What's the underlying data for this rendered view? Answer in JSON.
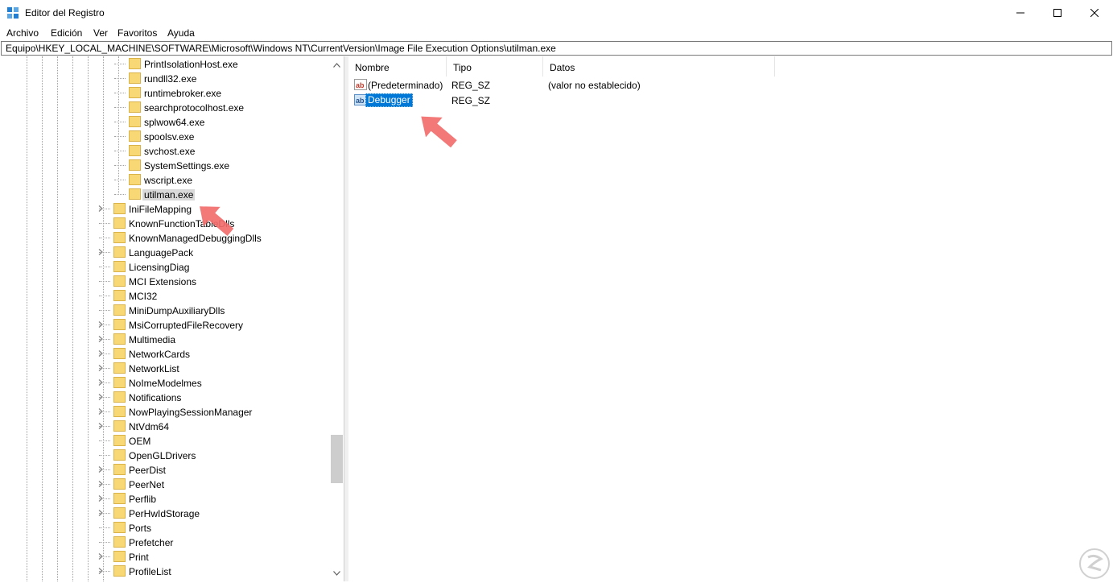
{
  "window": {
    "title": "Editor del Registro",
    "icon": "registry-editor-icon",
    "controls": [
      "minimize-icon",
      "maximize-icon",
      "close-icon"
    ]
  },
  "menu": [
    "Archivo",
    "Edición",
    "Ver",
    "Favoritos",
    "Ayuda"
  ],
  "address": "Equipo\\HKEY_LOCAL_MACHINE\\SOFTWARE\\Microsoft\\Windows NT\\CurrentVersion\\Image File Execution Options\\utilman.exe",
  "tree": {
    "children": [
      {
        "label": "PrintIsolationHost.exe"
      },
      {
        "label": "rundll32.exe"
      },
      {
        "label": "runtimebroker.exe"
      },
      {
        "label": "searchprotocolhost.exe"
      },
      {
        "label": "splwow64.exe"
      },
      {
        "label": "spoolsv.exe"
      },
      {
        "label": "svchost.exe"
      },
      {
        "label": "SystemSettings.exe"
      },
      {
        "label": "wscript.exe"
      },
      {
        "label": "utilman.exe",
        "selected": true
      }
    ],
    "siblings": [
      {
        "label": "IniFileMapping",
        "expandable": true
      },
      {
        "label": "KnownFunctionTableDlls",
        "expandable": false
      },
      {
        "label": "KnownManagedDebuggingDlls",
        "expandable": false
      },
      {
        "label": "LanguagePack",
        "expandable": true
      },
      {
        "label": "LicensingDiag",
        "expandable": false
      },
      {
        "label": "MCI Extensions",
        "expandable": false
      },
      {
        "label": "MCI32",
        "expandable": false
      },
      {
        "label": "MiniDumpAuxiliaryDlls",
        "expandable": false
      },
      {
        "label": "MsiCorruptedFileRecovery",
        "expandable": true
      },
      {
        "label": "Multimedia",
        "expandable": true
      },
      {
        "label": "NetworkCards",
        "expandable": true
      },
      {
        "label": "NetworkList",
        "expandable": true
      },
      {
        "label": "NoImeModelmes",
        "expandable": true
      },
      {
        "label": "Notifications",
        "expandable": true
      },
      {
        "label": "NowPlayingSessionManager",
        "expandable": true
      },
      {
        "label": "NtVdm64",
        "expandable": true
      },
      {
        "label": "OEM",
        "expandable": false
      },
      {
        "label": "OpenGLDrivers",
        "expandable": false
      },
      {
        "label": "PeerDist",
        "expandable": true
      },
      {
        "label": "PeerNet",
        "expandable": true
      },
      {
        "label": "Perflib",
        "expandable": true
      },
      {
        "label": "PerHwIdStorage",
        "expandable": true
      },
      {
        "label": "Ports",
        "expandable": false
      },
      {
        "label": "Prefetcher",
        "expandable": false
      },
      {
        "label": "Print",
        "expandable": true
      },
      {
        "label": "ProfileList",
        "expandable": true
      }
    ]
  },
  "list": {
    "columns": [
      "Nombre",
      "Tipo",
      "Datos"
    ],
    "rows": [
      {
        "name": "(Predeterminado)",
        "type": "REG_SZ",
        "data": "(valor no establecido)",
        "selected": false
      },
      {
        "name": "Debugger",
        "type": "REG_SZ",
        "data": "",
        "selected": true
      }
    ]
  },
  "colors": {
    "folder": "#f8d775",
    "folder_edge": "#d9b24a",
    "selection": "#0078d7",
    "tree_selection": "#d9d9d9",
    "arrow": "#f26d6d"
  }
}
